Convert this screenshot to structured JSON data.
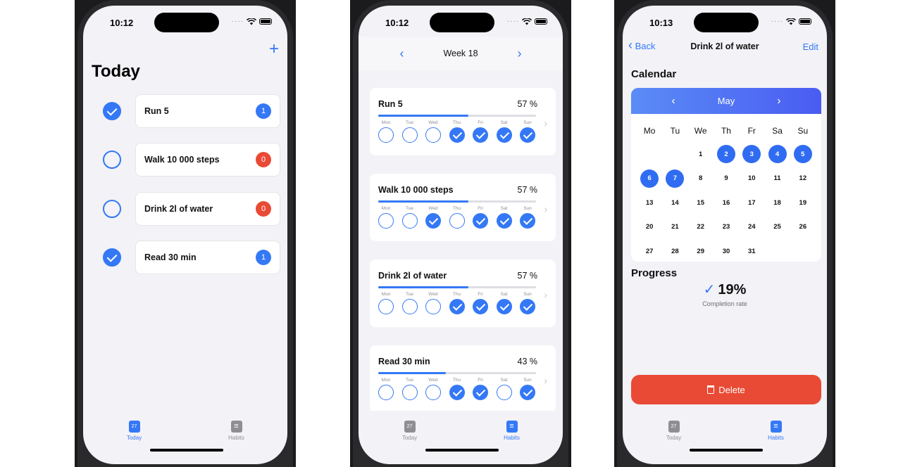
{
  "status": {
    "time1": "10:12",
    "time2": "10:12",
    "time3": "10:13"
  },
  "screen1": {
    "title": "Today",
    "add_icon": "plus-icon",
    "rows": [
      {
        "name": "Run 5",
        "done": true,
        "count": "1",
        "badge_color": "#3478f6"
      },
      {
        "name": "Walk 10 000 steps",
        "done": false,
        "count": "0",
        "badge_color": "#e94a35"
      },
      {
        "name": "Drink 2l of water",
        "done": false,
        "count": "0",
        "badge_color": "#e94a35"
      },
      {
        "name": "Read 30 min",
        "done": true,
        "count": "1",
        "badge_color": "#3478f6"
      }
    ]
  },
  "screen2": {
    "week_label": "Week 18",
    "day_labels": [
      "Mon",
      "Tue",
      "Wed",
      "Thu",
      "Fri",
      "Sat",
      "Sun"
    ],
    "habits": [
      {
        "name": "Run 5",
        "percent_label": "57 %",
        "percent": 57,
        "checks": [
          false,
          false,
          false,
          true,
          true,
          true,
          true
        ]
      },
      {
        "name": "Walk 10 000 steps",
        "percent_label": "57 %",
        "percent": 57,
        "checks": [
          false,
          false,
          true,
          false,
          true,
          true,
          true
        ]
      },
      {
        "name": "Drink 2l of water",
        "percent_label": "57 %",
        "percent": 57,
        "checks": [
          false,
          false,
          false,
          true,
          true,
          true,
          true
        ]
      },
      {
        "name": "Read 30 min",
        "percent_label": "43 %",
        "percent": 43,
        "checks": [
          false,
          false,
          false,
          true,
          true,
          false,
          true
        ]
      }
    ]
  },
  "screen3": {
    "back_label": "Back",
    "title": "Drink 2l of water",
    "edit_label": "Edit",
    "calendar_title": "Calendar",
    "month": "May",
    "weekday_heads": [
      "Mo",
      "Tu",
      "We",
      "Th",
      "Fr",
      "Sa",
      "Su"
    ],
    "weeks": [
      [
        "",
        "",
        "1",
        "2",
        "3",
        "4",
        "5"
      ],
      [
        "6",
        "7",
        "8",
        "9",
        "10",
        "11",
        "12"
      ],
      [
        "13",
        "14",
        "15",
        "16",
        "17",
        "18",
        "19"
      ],
      [
        "20",
        "21",
        "22",
        "23",
        "24",
        "25",
        "26"
      ],
      [
        "27",
        "28",
        "29",
        "30",
        "31",
        "",
        ""
      ]
    ],
    "selected_days": [
      "2",
      "3",
      "4",
      "5",
      "6",
      "7"
    ],
    "progress_title": "Progress",
    "progress_value": "19%",
    "progress_label": "Completion rate",
    "delete_label": "Delete"
  },
  "tabbar": {
    "today_label": "Today",
    "today_icon_text": "27",
    "habits_label": "Habits"
  },
  "colors": {
    "accent": "#3478f6",
    "danger": "#e94a35",
    "background": "#f2f2f7"
  }
}
